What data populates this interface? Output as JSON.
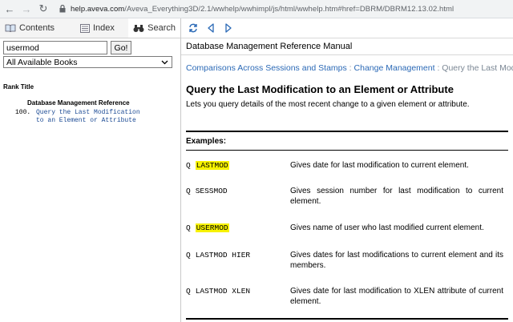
{
  "browser": {
    "url_host": "help.aveva.com",
    "url_path": "/Aveva_Everything3D/2.1/wwhelp/wwhimpl/js/html/wwhelp.htm#href=DBRM/DBRM12.13.02.html"
  },
  "left": {
    "tabs": [
      {
        "label": "Contents"
      },
      {
        "label": "Index"
      },
      {
        "label": "Search"
      }
    ],
    "search": {
      "value": "usermod",
      "go_label": "Go!"
    },
    "book_select": {
      "selected": "All Available Books"
    },
    "rank_title": "Rank Title",
    "results": {
      "group": "Database Management Reference",
      "items": [
        {
          "rank": "100.",
          "text": "Query the Last Modification to an Element or Attribute"
        }
      ]
    }
  },
  "right": {
    "manual_title": "Database Management Reference Manual",
    "breadcrumb": {
      "part1": "Comparisons Across Sessions and Stamps",
      "sep": " : ",
      "part2": "Change Management",
      "part3": "Query the Last Modifica"
    },
    "page_title": "Query the Last Modification to an Element or Attribute",
    "description": "Lets you query details of the most recent change to a given element or attribute.",
    "examples_heading": "Examples:",
    "examples": [
      {
        "q": "Q",
        "cmd": "LASTMOD",
        "highlight": true,
        "desc": "Gives date for last modification to current element."
      },
      {
        "q": "Q",
        "cmd": "SESSMOD",
        "highlight": false,
        "desc": "Gives session number for last modification to current element."
      },
      {
        "q": "Q",
        "cmd": "USERMOD",
        "highlight": true,
        "desc": "Gives name of user who last modified current element."
      },
      {
        "q": "Q",
        "cmd": "LASTMOD HIER",
        "highlight": false,
        "desc": "Gives dates for last modifications to current element and its members."
      },
      {
        "q": "Q",
        "cmd": "LASTMOD XLEN",
        "highlight": false,
        "desc": "Gives date for last modification to XLEN attribute of current element."
      }
    ]
  },
  "colors": {
    "link": "#2b69b6",
    "highlight": "#f7f200"
  }
}
